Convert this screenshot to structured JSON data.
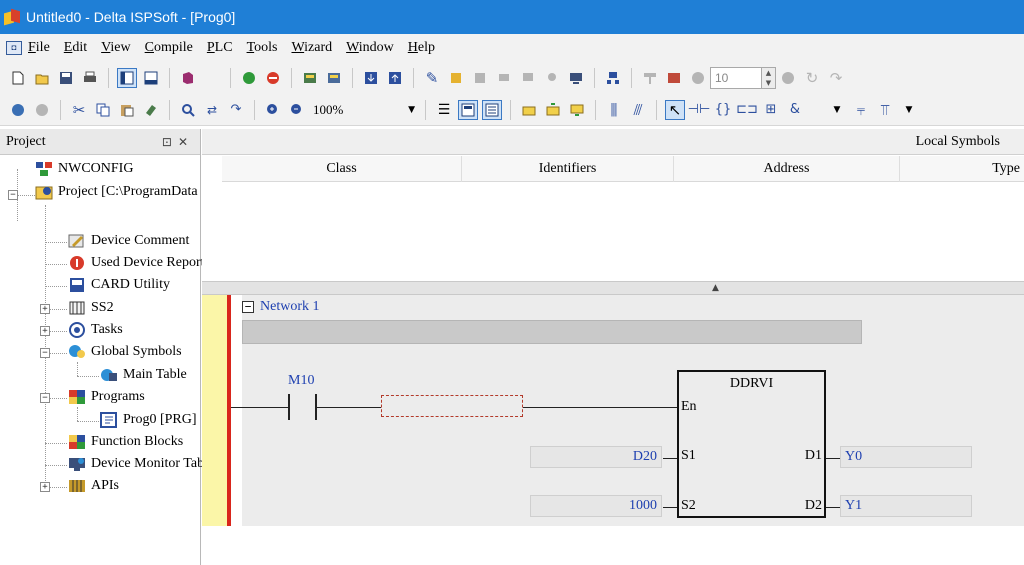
{
  "window": {
    "title": "Untitled0 - Delta ISPSoft - [Prog0]"
  },
  "menu": {
    "sys_icon": "◘",
    "items": [
      "File",
      "Edit",
      "View",
      "Compile",
      "PLC",
      "Tools",
      "Wizard",
      "Window",
      "Help"
    ]
  },
  "toolbar": {
    "zoom_level": "100%",
    "spin_value": "10"
  },
  "project_panel": {
    "title": "Project",
    "pin_glyph": "⊡",
    "close_glyph": "✕",
    "tree": [
      {
        "label": "NWCONFIG",
        "icon": "network-config-icon"
      },
      {
        "label": "Project [C:\\ProgramData",
        "icon": "project-icon",
        "expanded": true
      },
      {
        "label": "Device Comment",
        "icon": "device-comment-icon"
      },
      {
        "label": "Used Device Report",
        "icon": "used-device-icon"
      },
      {
        "label": "CARD Utility",
        "icon": "card-utility-icon"
      },
      {
        "label": "SS2",
        "icon": "plc-module-icon",
        "collapsed": true
      },
      {
        "label": "Tasks",
        "icon": "tasks-icon",
        "collapsed": true
      },
      {
        "label": "Global Symbols",
        "icon": "global-symbols-icon",
        "expanded": true
      },
      {
        "label": "Main Table",
        "icon": "main-table-icon"
      },
      {
        "label": "Programs",
        "icon": "programs-icon",
        "expanded": true
      },
      {
        "label": "Prog0 [PRG]",
        "icon": "program-file-icon"
      },
      {
        "label": "Function Blocks",
        "icon": "function-blocks-icon"
      },
      {
        "label": "Device Monitor Table",
        "icon": "device-monitor-icon"
      },
      {
        "label": "APIs",
        "icon": "apis-icon",
        "collapsed": true
      }
    ]
  },
  "symbols": {
    "title": "Local Symbols",
    "columns": [
      "Class",
      "Identifiers",
      "Address",
      "Type"
    ]
  },
  "ladder": {
    "network_title": "Network 1",
    "contact_device": "M10",
    "function": {
      "name": "DDRVI",
      "pin_en": "En",
      "pin_s1": "S1",
      "pin_s2": "S2",
      "pin_d1": "D1",
      "pin_d2": "D2"
    },
    "operands": {
      "s1": "D20",
      "s2": "1000",
      "d1": "Y0",
      "d2": "Y1"
    }
  },
  "colors": {
    "titlebar": "#1f7fd6",
    "rail": "#d9261c",
    "rail_margin": "#fbf6a8",
    "operand_text": "#1d3fb0"
  }
}
